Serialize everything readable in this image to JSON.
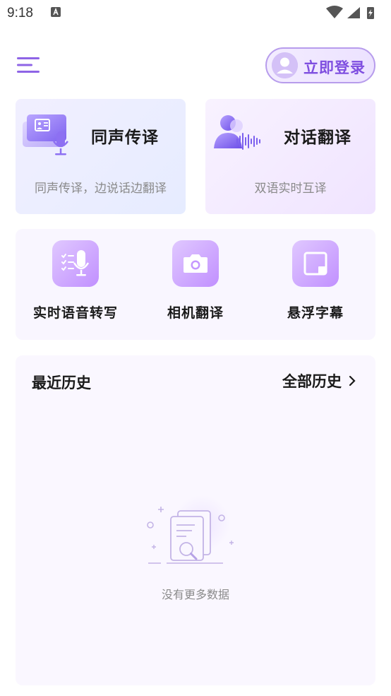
{
  "status_bar": {
    "time": "9:18"
  },
  "header": {
    "login_label": "立即登录"
  },
  "cards": [
    {
      "title": "同声传译",
      "subtitle": "同声传译，边说话边翻译"
    },
    {
      "title": "对话翻译",
      "subtitle": "双语实时互译"
    }
  ],
  "tools": [
    {
      "label": "实时语音转写",
      "icon": "mic-list-icon"
    },
    {
      "label": "相机翻译",
      "icon": "camera-icon"
    },
    {
      "label": "悬浮字幕",
      "icon": "floating-window-icon"
    }
  ],
  "history": {
    "title": "最近历史",
    "all_label": "全部历史",
    "empty_text": "没有更多数据"
  },
  "colors": {
    "accent": "#7f4fe0",
    "tool_gradient_start": "#e0c8ff",
    "tool_gradient_end": "#c190ff"
  }
}
